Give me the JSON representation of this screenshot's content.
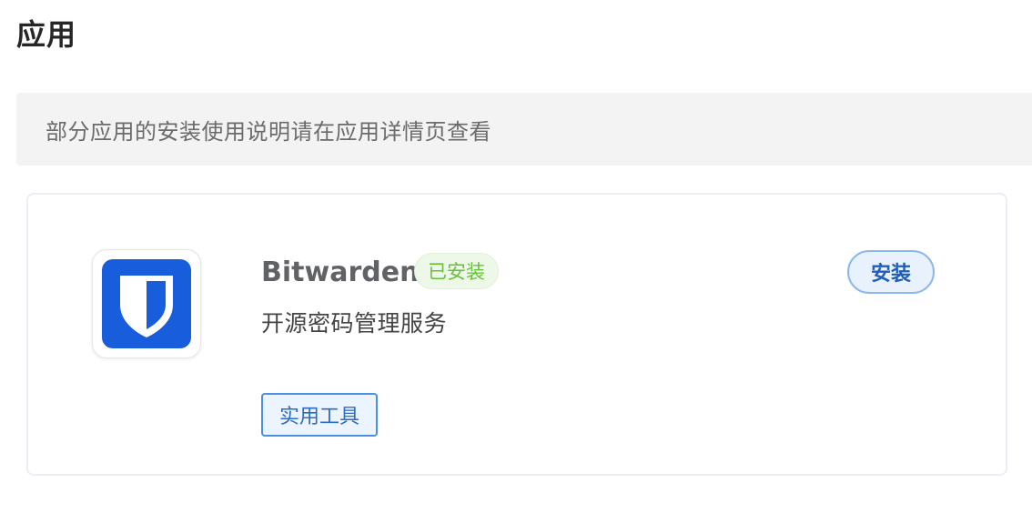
{
  "page": {
    "title": "应用"
  },
  "notice": {
    "text": "部分应用的安装使用说明请在应用详情页查看"
  },
  "app": {
    "name": "Bitwarden",
    "status_badge": "已安装",
    "description": "开源密码管理服务",
    "category": "实用工具",
    "install_label": "安装",
    "logo_icon": "bitwarden-shield-icon",
    "colors": {
      "brand": "#175DDC",
      "installed_text": "#67C23A",
      "install_button_text": "#1F5FB8"
    }
  }
}
